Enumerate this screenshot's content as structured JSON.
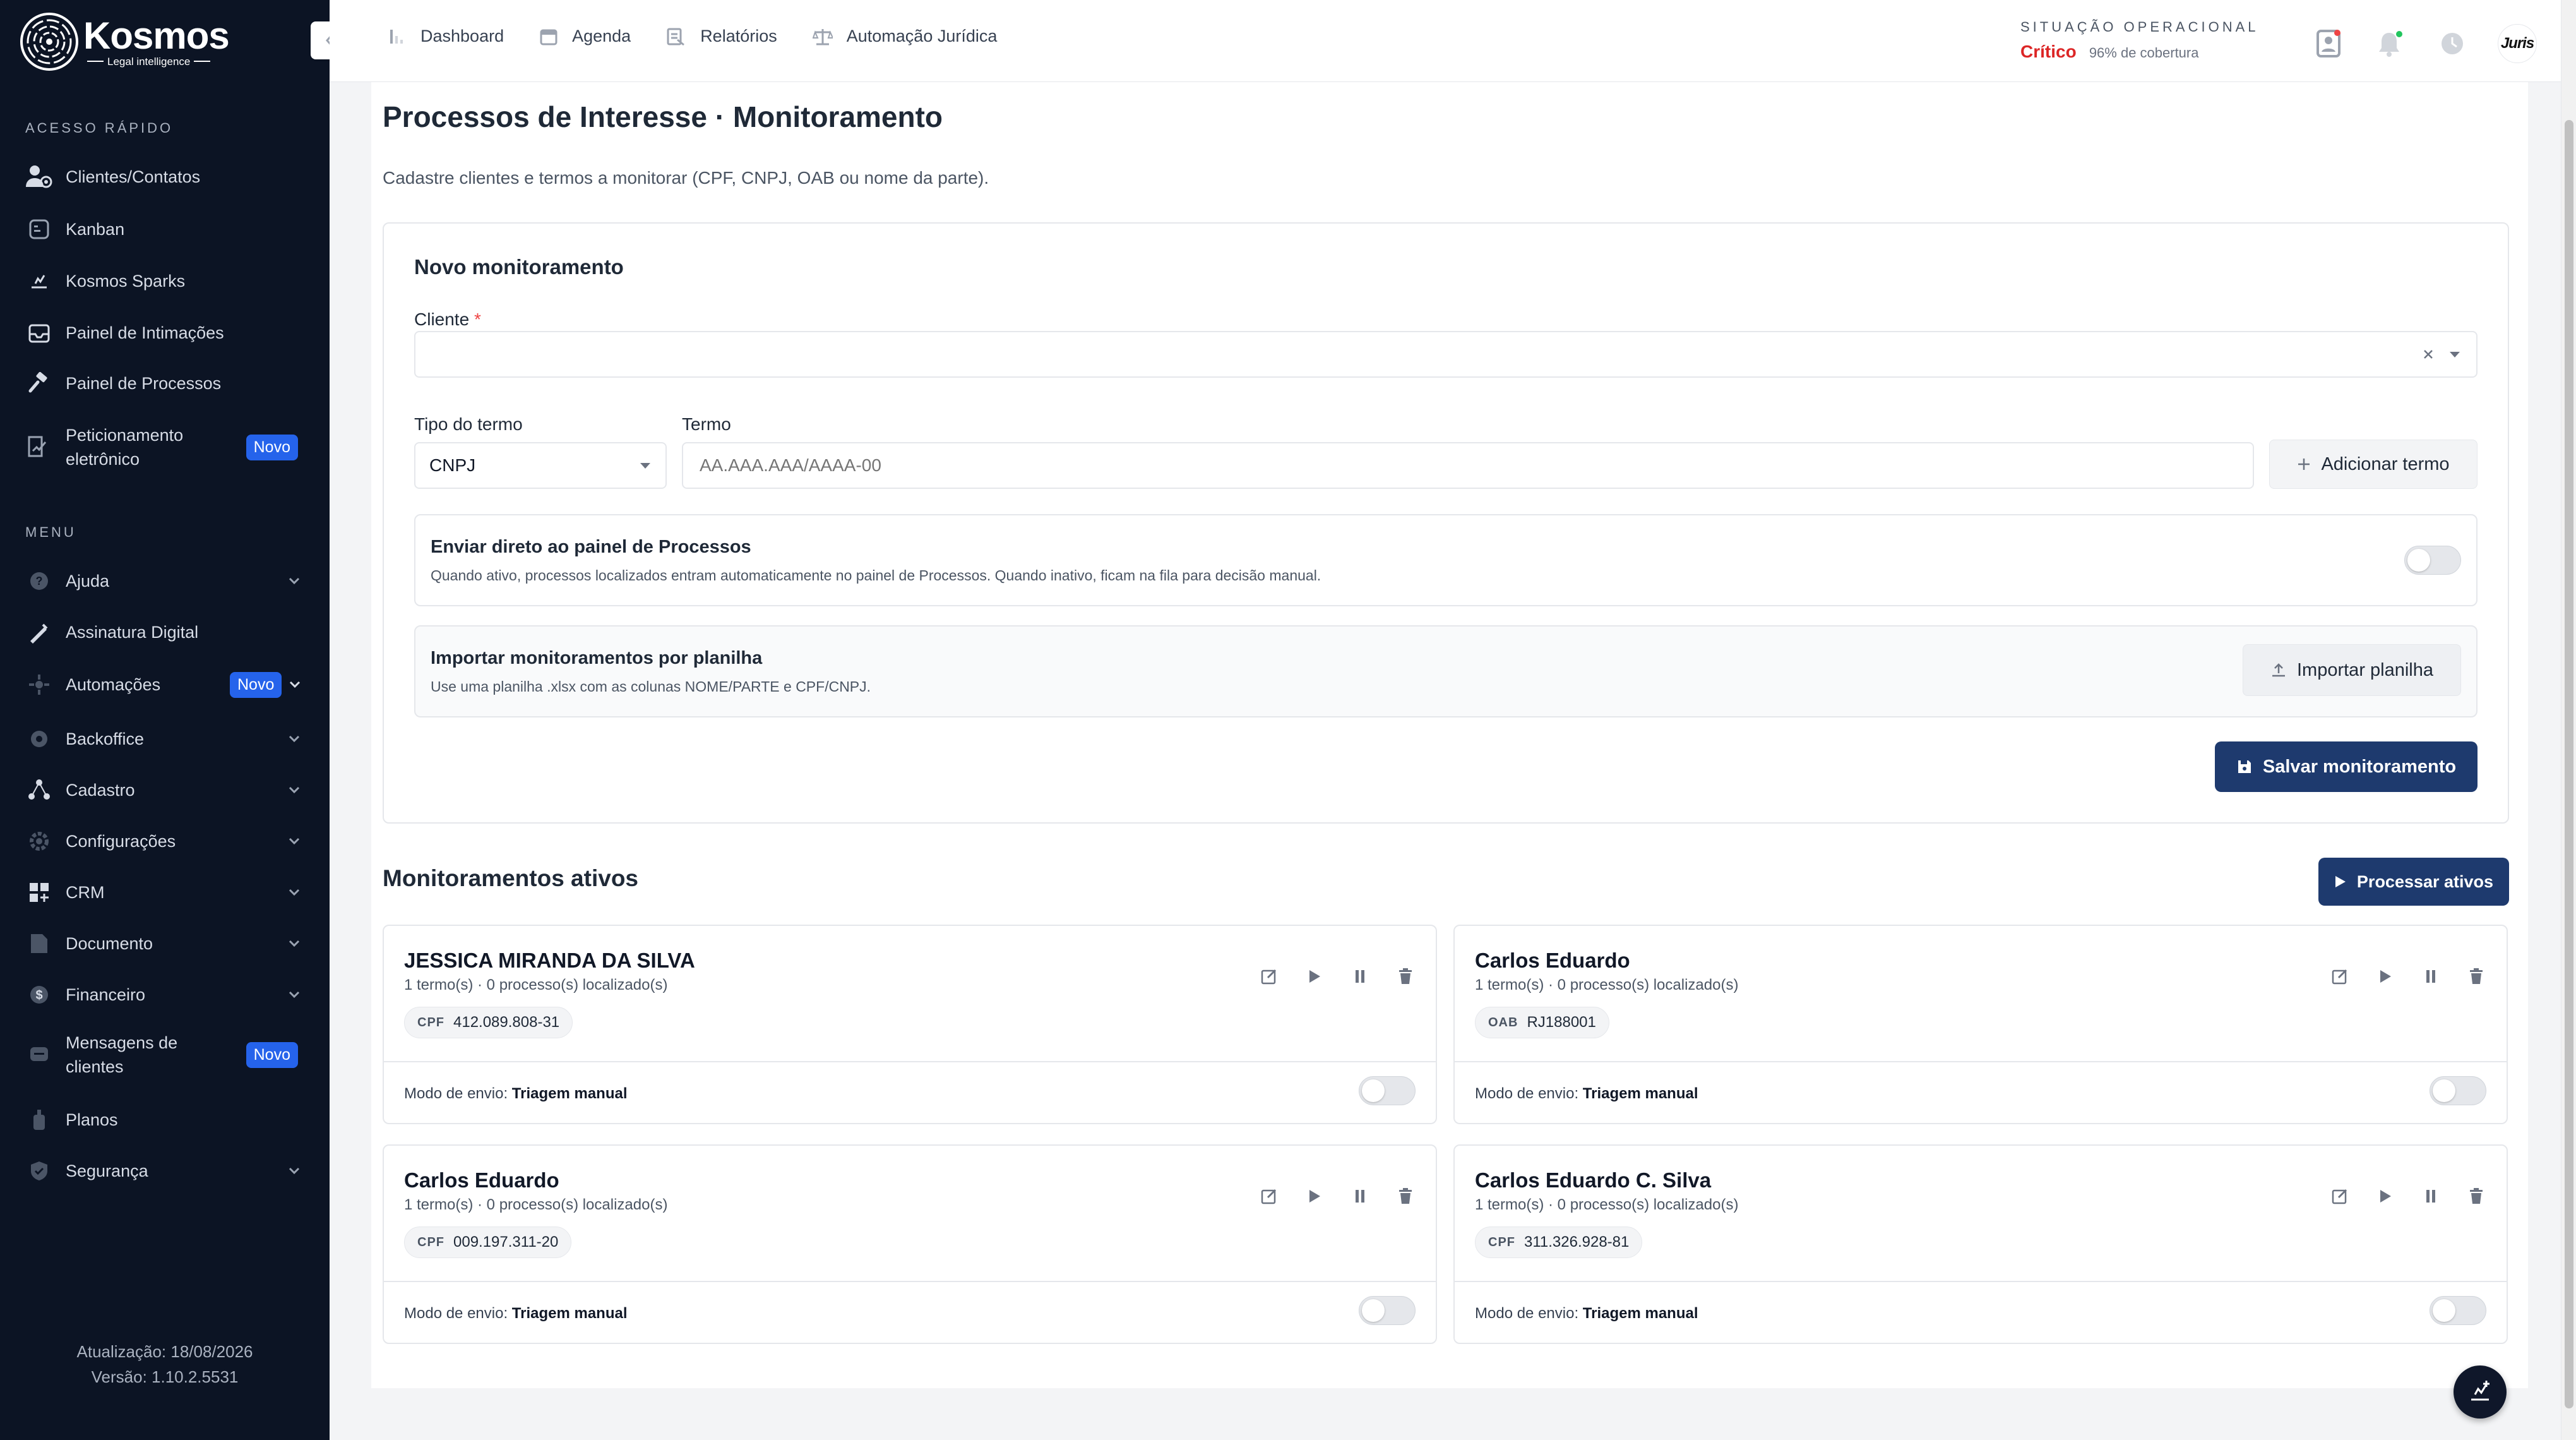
{
  "brand": {
    "name": "Kosmos",
    "tagline": "Legal intelligence"
  },
  "sidebar": {
    "quick_access_label": "ACESSO RÁPIDO",
    "quick": [
      {
        "label": "Clientes/Contatos",
        "icon": "users-icon"
      },
      {
        "label": "Kanban",
        "icon": "kanban-icon"
      },
      {
        "label": "Kosmos Sparks",
        "icon": "sparks-icon"
      },
      {
        "label": "Painel de Intimações",
        "icon": "inbox-icon"
      },
      {
        "label": "Painel de Processos",
        "icon": "gavel-icon"
      },
      {
        "label": "Peticionamento eletrônico",
        "icon": "document-edit-icon",
        "badge": "Novo"
      }
    ],
    "menu_label": "MENU",
    "menu": [
      {
        "label": "Ajuda",
        "icon": "help-icon"
      },
      {
        "label": "Assinatura Digital",
        "icon": "signature-icon"
      },
      {
        "label": "Automações",
        "icon": "automation-icon",
        "badge": "Novo"
      },
      {
        "label": "Backoffice",
        "icon": "backoffice-icon"
      },
      {
        "label": "Cadastro",
        "icon": "cadastro-icon"
      },
      {
        "label": "Configurações",
        "icon": "settings-icon"
      },
      {
        "label": "CRM",
        "icon": "crm-icon"
      },
      {
        "label": "Documento",
        "icon": "file-icon"
      },
      {
        "label": "Financeiro",
        "icon": "dollar-icon"
      },
      {
        "label": "Mensagens de clientes",
        "icon": "message-icon",
        "badge": "Novo"
      },
      {
        "label": "Planos",
        "icon": "plan-icon"
      },
      {
        "label": "Segurança",
        "icon": "shield-icon"
      }
    ],
    "footer": {
      "update": "Atualização: 18/08/2026",
      "version": "Versão: 1.10.2.5531"
    }
  },
  "topbar": {
    "nav": [
      {
        "label": "Dashboard",
        "icon": "chart-icon"
      },
      {
        "label": "Agenda",
        "icon": "calendar-icon"
      },
      {
        "label": "Relatórios",
        "icon": "report-icon"
      },
      {
        "label": "Automação Jurídica",
        "icon": "scale-icon"
      }
    ],
    "status_label": "SITUAÇÃO OPERACIONAL",
    "status_value": "Crítico",
    "coverage": "96% de cobertura",
    "avatar_text": "Juris"
  },
  "page": {
    "title": "Processos de Interesse · Monitoramento",
    "subtitle": "Cadastre clientes e termos a monitorar (CPF, CNPJ, OAB ou nome da parte)."
  },
  "form": {
    "title": "Novo monitoramento",
    "client_label": "Cliente",
    "client_required": "*",
    "client_value": "",
    "term_type_label": "Tipo do termo",
    "term_type_value": "CNPJ",
    "term_label": "Termo",
    "term_placeholder": "AA.AAA.AAA/AAAA-00",
    "add_term_label": "Adicionar termo",
    "direct": {
      "title": "Enviar direto ao painel de Processos",
      "desc": "Quando ativo, processos localizados entram automaticamente no painel de Processos. Quando inativo, ficam na fila para decisão manual.",
      "enabled": false
    },
    "import": {
      "title": "Importar monitoramentos por planilha",
      "desc": "Use uma planilha .xlsx com as colunas NOME/PARTE e CPF/CNPJ.",
      "button": "Importar planilha"
    },
    "save_label": "Salvar monitoramento"
  },
  "active": {
    "title": "Monitoramentos ativos",
    "process_label": "Processar ativos",
    "mode_prefix": "Modo de envio:",
    "cards": [
      {
        "name": "JESSICA MIRANDA DA SILVA",
        "meta": "1 termo(s) · 0 processo(s) localizado(s)",
        "term_type": "CPF",
        "term": "412.089.808-31",
        "mode": "Triagem manual"
      },
      {
        "name": "Carlos Eduardo",
        "meta": "1 termo(s) · 0 processo(s) localizado(s)",
        "term_type": "OAB",
        "term": "RJ188001",
        "mode": "Triagem manual"
      },
      {
        "name": "Carlos Eduardo",
        "meta": "1 termo(s) · 0 processo(s) localizado(s)",
        "term_type": "CPF",
        "term": "009.197.311-20",
        "mode": "Triagem manual"
      },
      {
        "name": "Carlos Eduardo C. Silva",
        "meta": "1 termo(s) · 0 processo(s) localizado(s)",
        "term_type": "CPF",
        "term": "311.326.928-81",
        "mode": "Triagem manual"
      }
    ]
  },
  "colors": {
    "sidebar_bg": "#0c1424",
    "primary": "#1e3a6e",
    "badge": "#2563eb",
    "critical": "#dc2626"
  }
}
